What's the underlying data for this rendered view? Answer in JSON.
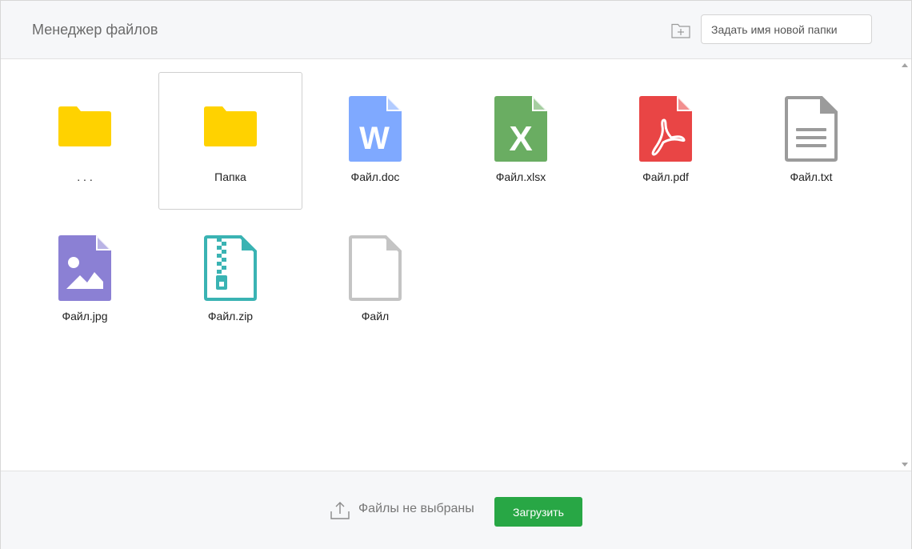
{
  "header": {
    "title": "Менеджер файлов",
    "new_folder_placeholder": "Задать имя новой папки",
    "add_folder_icon": "folder-plus-icon"
  },
  "items": [
    {
      "label": ". . .",
      "type": "folder",
      "icon": "folder-icon",
      "color": "#ffd200",
      "selected": false
    },
    {
      "label": "Папка",
      "type": "folder",
      "icon": "folder-icon",
      "color": "#ffd200",
      "selected": true
    },
    {
      "label": "Файл.doc",
      "type": "doc",
      "icon": "word-file-icon",
      "color": "#7fa9ff",
      "selected": false
    },
    {
      "label": "Файл.xlsx",
      "type": "xlsx",
      "icon": "excel-file-icon",
      "color": "#6aad62",
      "selected": false
    },
    {
      "label": "Файл.pdf",
      "type": "pdf",
      "icon": "pdf-file-icon",
      "color": "#e94545",
      "selected": false
    },
    {
      "label": "Файл.txt",
      "type": "txt",
      "icon": "text-file-icon",
      "color": "#9b9b9b",
      "selected": false
    },
    {
      "label": "Файл.jpg",
      "type": "jpg",
      "icon": "image-file-icon",
      "color": "#8b80d4",
      "selected": false
    },
    {
      "label": "Файл.zip",
      "type": "zip",
      "icon": "zip-file-icon",
      "color": "#3ab3b3",
      "selected": false
    },
    {
      "label": "Файл",
      "type": "file",
      "icon": "generic-file-icon",
      "color": "#c4c4c4",
      "selected": false
    }
  ],
  "footer": {
    "files_status": "Файлы не выбраны",
    "upload_label": "Загрузить",
    "upload_icon": "upload-icon",
    "upload_button_color": "#28a745"
  }
}
